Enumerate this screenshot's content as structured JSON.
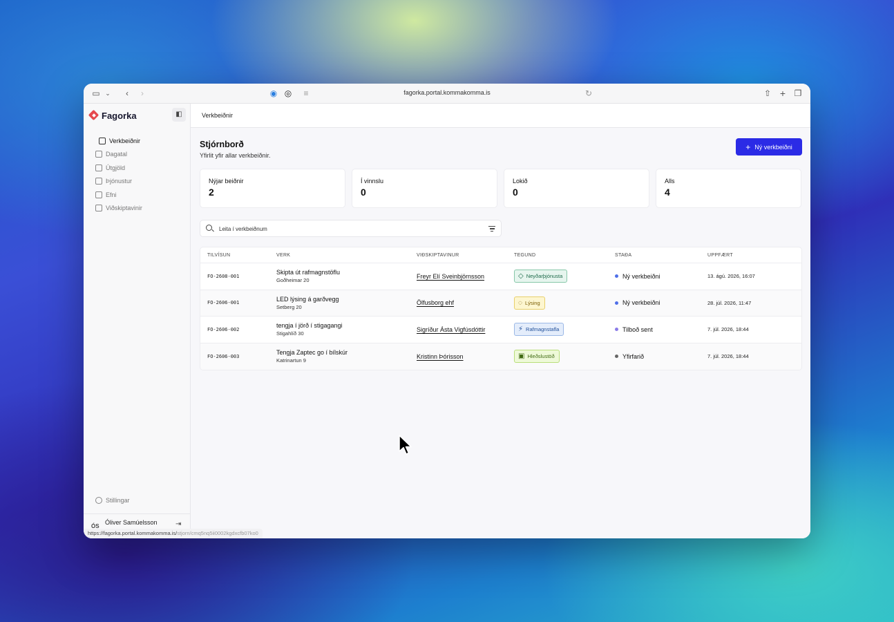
{
  "browser": {
    "url": "fagorka.portal.kommakomma.is",
    "status_url_host": "https://fagorka.portal.kommakomma.is/",
    "status_url_path": "stjorn/cmq5nq5ii0002kgdxcfb07ko0"
  },
  "sidebar": {
    "brand": "Fagorka",
    "items": [
      {
        "label": "Verkbeiðnir",
        "icon": "clipboard-icon",
        "active": true
      },
      {
        "label": "Dagatal",
        "icon": "calendar-icon"
      },
      {
        "label": "Útgjöld",
        "icon": "receipt-icon"
      },
      {
        "label": "Þjónustur",
        "icon": "briefcase-icon"
      },
      {
        "label": "Efni",
        "icon": "package-icon"
      },
      {
        "label": "Viðskiptavinir",
        "icon": "contact-icon"
      }
    ],
    "settings_label": "Stillingar",
    "user": {
      "initials": "ÓS",
      "name": "Óliver Samúelsson"
    }
  },
  "main": {
    "breadcrumb": "Verkbeiðnir",
    "title": "Stjórnborð",
    "subtitle": "Yfirlit yfir allar verkbeiðnir.",
    "new_button": "Ný verkbeiðni",
    "stats": [
      {
        "label": "Nýjar beiðnir",
        "value": "2"
      },
      {
        "label": "Í vinnslu",
        "value": "0"
      },
      {
        "label": "Lokið",
        "value": "0"
      },
      {
        "label": "Alls",
        "value": "4"
      }
    ],
    "search_placeholder": "Leita í verkbeiðnum",
    "table": {
      "headers": [
        "TILVÍSUN",
        "VERK",
        "VIÐSKIPTAVINUR",
        "TEGUND",
        "STAÐA",
        "UPPFÆRT"
      ],
      "rows": [
        {
          "ref": "FO-2608-001",
          "title": "Skipta út rafmagnstöflu",
          "address": "Goðheimar 20",
          "customer": "Freyr Elí Sveinbjörnsson",
          "type": "Neyðarþjónusta",
          "status": "Ný verkbeiðni",
          "updated": "13. ágú. 2026, 16:07"
        },
        {
          "ref": "FO-2606-001",
          "title": "LED lýsing á garðvegg",
          "address": "Setberg 20",
          "customer": "Ölfusborg ehf",
          "type": "Lýsing",
          "status": "Ný verkbeiðni",
          "updated": "28. júl. 2026, 11:47"
        },
        {
          "ref": "FO-2606-002",
          "title": "tengja í jörð í stigagangi",
          "address": "Stigahlíð 30",
          "customer": "Sigríður Ásta Vigfúsdóttir",
          "type": "Rafmagnstafla",
          "status": "Tilboð sent",
          "updated": "7. júl. 2026, 18:44"
        },
        {
          "ref": "FO-2606-003",
          "title": "Tengja Zaptec go í bílskúr",
          "address": "Katrinartun 9",
          "customer": "Kristinn Þórisson",
          "type": "Hleðslustöð",
          "status": "Yfirfarið",
          "updated": "7. júl. 2026, 18:44"
        }
      ]
    }
  },
  "colors": {
    "accent": "#2b2be6",
    "status_new": "#4f6fe8",
    "status_offer": "#8a7be8",
    "status_reviewed": "#666666"
  }
}
